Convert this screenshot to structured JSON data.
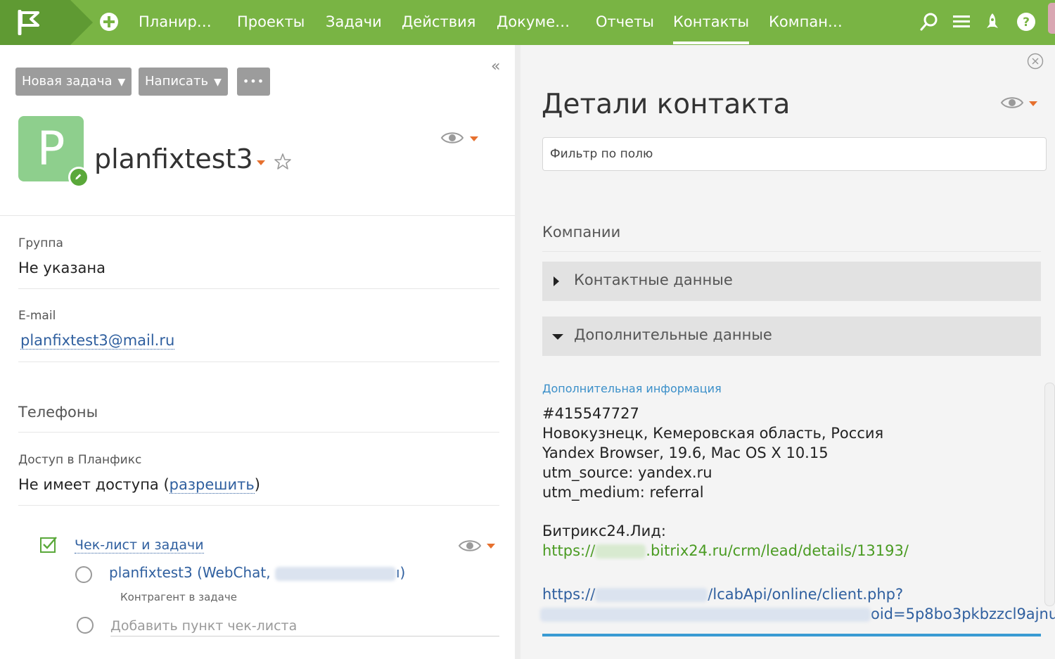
{
  "nav": {
    "items": [
      {
        "label": "Планир…"
      },
      {
        "label": "Проекты"
      },
      {
        "label": "Задачи"
      },
      {
        "label": "Действия"
      },
      {
        "label": "Докуме…"
      },
      {
        "label": "Отчеты"
      },
      {
        "label": "Контакты",
        "active": true
      },
      {
        "label": "Компан…"
      }
    ],
    "icons": [
      "plus-circle-icon",
      "search-icon",
      "menu-icon",
      "rocket-icon",
      "help-icon"
    ]
  },
  "toolbar": {
    "new_task_label": "Новая задача",
    "write_label": "Написать",
    "more_label": "•••",
    "collapse_glyph": "«"
  },
  "contact": {
    "avatar_letter": "P",
    "name": "planfixtest3"
  },
  "fields": {
    "group_label": "Группа",
    "group_value": "Не указана",
    "email_label": "E-mail",
    "email_value": "planfixtest3@mail.ru",
    "phones_title": "Телефоны",
    "access_label": "Доступ в Планфикс",
    "access_value_prefix": "Не имеет доступа (",
    "access_link": "разрешить",
    "access_value_suffix": ")"
  },
  "checklist": {
    "title": "Чек-лист и задачи",
    "item_prefix": "planfixtest3 (WebChat,",
    "item_suffix": "ı)",
    "item_sub": "Контрагент в задаче",
    "add_placeholder": "Добавить пункт чек-листа"
  },
  "details": {
    "title": "Детали контакта",
    "filter_placeholder": "Фильтр по полю",
    "companies_title": "Компании",
    "contact_data_label": "Контактные данные",
    "extra_data_label": "Дополнительные данные",
    "extra_info_label": "Дополнительная информация",
    "lines": [
      "#415547727",
      "Новокузнецк, Кемеровская область, Россия",
      "Yandex Browser, 19.6, Mac OS X 10.15",
      "utm_source: yandex.ru",
      "utm_medium: referral"
    ],
    "bitrix_label": "Битрикс24.Лид:",
    "bitrix_link_prefix": "https://",
    "bitrix_link_suffix": ".bitrix24.ru/crm/lead/details/13193/",
    "api_link_prefix": "https://",
    "api_link_suffix": "/lcabApi/online/client.php?",
    "api_link_tail": "oid=5p8bo3pkbzzcl9ajnu"
  },
  "colors": {
    "nav_bg": "#79b444",
    "logo_bg": "#5f9a33",
    "accent_orange": "#e6702e",
    "link_blue": "#2f5f9f",
    "link_green": "#4a9b22",
    "info_blue": "#3a8fc9"
  }
}
